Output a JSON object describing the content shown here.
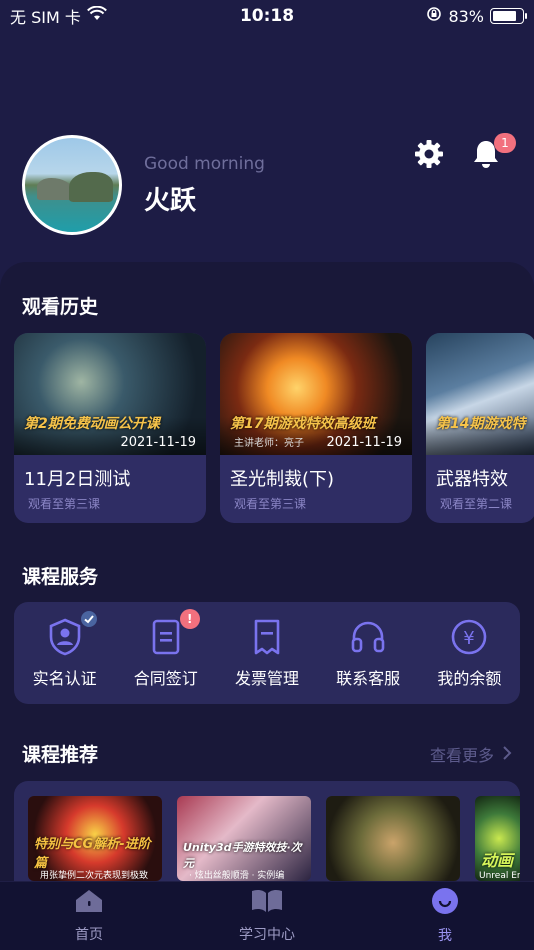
{
  "status_bar": {
    "carrier": "无 SIM 卡",
    "time": "10:18",
    "battery_percent": "83%",
    "battery_level": 0.83
  },
  "header": {
    "greeting": "Good morning",
    "username": "火跃",
    "notification_count": "1"
  },
  "history": {
    "title": "观看历史",
    "items": [
      {
        "thumb_title": "第2期免费动画公开课",
        "thumb_sub": "",
        "date": "2021-11-19",
        "name": "11月2日测试",
        "progress": "观看至第三课"
      },
      {
        "thumb_title": "第17期游戏特效高级班",
        "thumb_sub": "主讲老师：亮子",
        "date": "2021-11-19",
        "name": "圣光制裁(下)",
        "progress": "观看至第三课"
      },
      {
        "thumb_title": "第14期游戏特",
        "thumb_sub": "",
        "date": "",
        "name": "武器特效",
        "progress": "观看至第二课"
      }
    ]
  },
  "services": {
    "title": "课程服务",
    "items": [
      {
        "label": "实名认证",
        "icon": "user-verify-icon"
      },
      {
        "label": "合同签订",
        "icon": "contract-icon",
        "badge": "!"
      },
      {
        "label": "发票管理",
        "icon": "invoice-icon"
      },
      {
        "label": "联系客服",
        "icon": "headset-icon"
      },
      {
        "label": "我的余额",
        "icon": "yuan-coin-icon",
        "symbol": "¥"
      }
    ]
  },
  "recommend": {
    "title": "课程推荐",
    "more": "查看更多",
    "items": [
      {
        "text": "特别与CG解析-进阶篇",
        "sub": "用张挚例二次元表现到极致"
      },
      {
        "text": "Unity3d手游特效技·次元",
        "sub": "· 炫出丝般顺滑 · 实例编"
      },
      {
        "text": "",
        "sub": ""
      },
      {
        "text": "动画",
        "sub": "Unreal Eng"
      }
    ]
  },
  "tabbar": {
    "items": [
      {
        "label": "首页",
        "icon": "home-icon"
      },
      {
        "label": "学习中心",
        "icon": "book-icon"
      },
      {
        "label": "我",
        "icon": "smile-icon",
        "active": true
      }
    ]
  },
  "colors": {
    "background": "#1d1c45",
    "panel": "#191839",
    "card": "#2f2d64",
    "accent": "#7a73ee",
    "badge": "#f2707e"
  }
}
